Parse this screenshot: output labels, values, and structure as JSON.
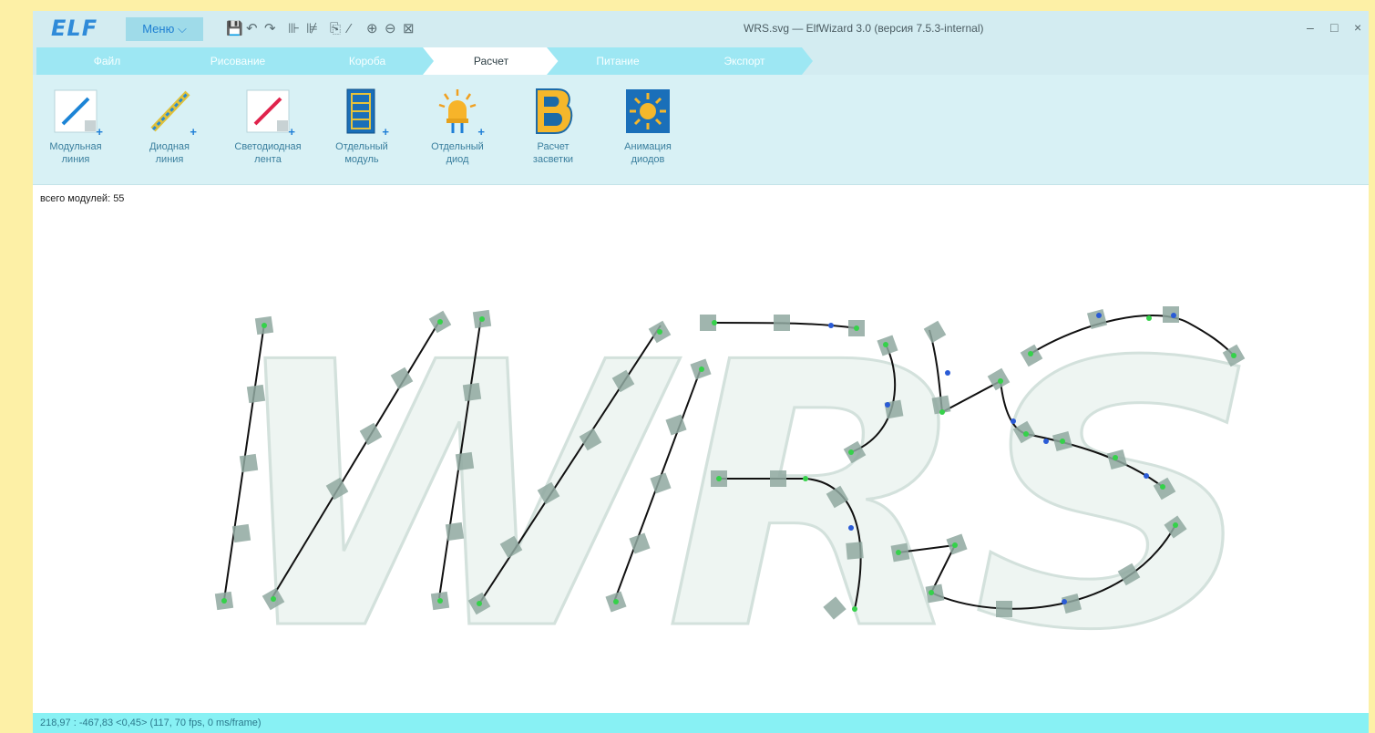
{
  "app": {
    "logo": "ELF",
    "menu_label": "Меню",
    "window_title": "WRS.svg — ElfWizard 3.0 (версия 7.5.3-internal)"
  },
  "tabs": [
    {
      "label": "Файл",
      "active": false
    },
    {
      "label": "Рисование",
      "active": false
    },
    {
      "label": "Короба",
      "active": false
    },
    {
      "label": "Расчет",
      "active": true
    },
    {
      "label": "Питание",
      "active": false
    },
    {
      "label": "Экспорт",
      "active": false
    }
  ],
  "tools": [
    {
      "line1": "Модульная",
      "line2": "линия",
      "icon": "modular-line-icon"
    },
    {
      "line1": "Диодная",
      "line2": "линия",
      "icon": "diode-line-icon"
    },
    {
      "line1": "Светодиодная",
      "line2": "лента",
      "icon": "led-strip-icon"
    },
    {
      "line1": "Отдельный",
      "line2": "модуль",
      "icon": "single-module-icon"
    },
    {
      "line1": "Отдельный",
      "line2": "диод",
      "icon": "single-diode-icon"
    },
    {
      "line1": "Расчет",
      "line2": "засветки",
      "icon": "illumination-calc-icon"
    },
    {
      "line1": "Анимация",
      "line2": "диодов",
      "icon": "diode-animation-icon"
    }
  ],
  "canvas": {
    "module_count_label": "всего модулей: 55",
    "drawing_text": "WRS"
  },
  "status": {
    "text": "218,97 : -467,83 <0,45> (117, 70 fps,   0 ms/frame)"
  },
  "colors": {
    "accent": "#2f8bd9",
    "ribbon": "#d8f1f5",
    "tab": "#9de7f3",
    "status": "#88f1f4",
    "module": "#8fa8a0",
    "node": "#35d14a",
    "control_point": "#2a5bd6"
  }
}
